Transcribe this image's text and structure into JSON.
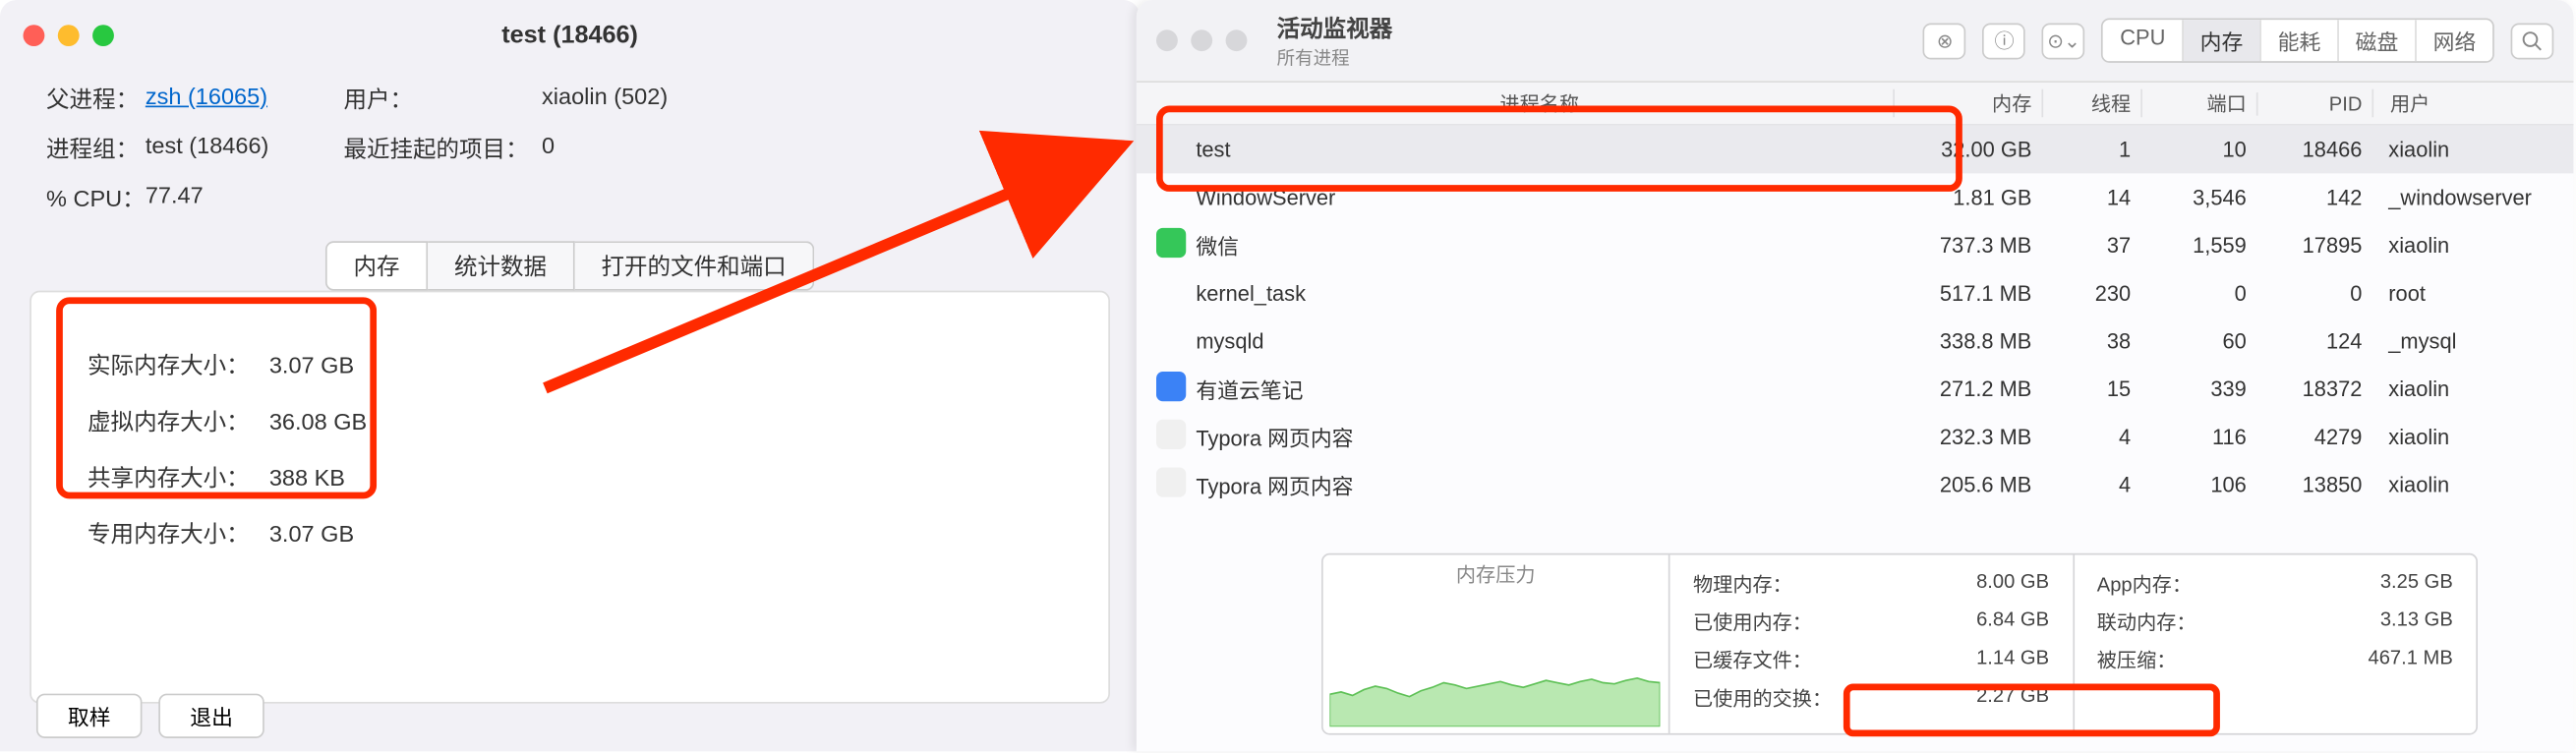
{
  "left": {
    "title": "test (18466)",
    "parent_label": "父进程：",
    "parent_value": "zsh (16065)",
    "user_label": "用户：",
    "user_value": "xiaolin (502)",
    "group_label": "进程组：",
    "group_value": "test (18466)",
    "recent_label": "最近挂起的项目：",
    "recent_value": "0",
    "cpu_label": "% CPU：",
    "cpu_value": "77.47",
    "tabs": {
      "mem": "内存",
      "stats": "统计数据",
      "files": "打开的文件和端口"
    },
    "mem": {
      "real_label": "实际内存大小：",
      "real_value": "3.07 GB",
      "virt_label": "虚拟内存大小：",
      "virt_value": "36.08 GB",
      "shared_label": "共享内存大小：",
      "shared_value": "388 KB",
      "private_label": "专用内存大小：",
      "private_value": "3.07 GB"
    },
    "buttons": {
      "sample": "取样",
      "quit": "退出"
    }
  },
  "right": {
    "title": "活动监视器",
    "subtitle": "所有进程",
    "segs": {
      "cpu": "CPU",
      "mem": "内存",
      "energy": "能耗",
      "disk": "磁盘",
      "net": "网络"
    },
    "headers": {
      "name": "进程名称",
      "mem": "内存",
      "threads": "线程",
      "ports": "端口",
      "pid": "PID",
      "user": "用户"
    },
    "rows": [
      {
        "name": "test",
        "mem": "32.00 GB",
        "threads": "1",
        "ports": "10",
        "pid": "18466",
        "user": "xiaolin",
        "icon": ""
      },
      {
        "name": "WindowServer",
        "mem": "1.81 GB",
        "threads": "14",
        "ports": "3,546",
        "pid": "142",
        "user": "_windowserver",
        "icon": ""
      },
      {
        "name": "微信",
        "mem": "737.3 MB",
        "threads": "37",
        "ports": "1,559",
        "pid": "17895",
        "user": "xiaolin",
        "icon": "#35c759"
      },
      {
        "name": "kernel_task",
        "mem": "517.1 MB",
        "threads": "230",
        "ports": "0",
        "pid": "0",
        "user": "root",
        "icon": ""
      },
      {
        "name": "mysqld",
        "mem": "338.8 MB",
        "threads": "38",
        "ports": "60",
        "pid": "124",
        "user": "_mysql",
        "icon": ""
      },
      {
        "name": "有道云笔记",
        "mem": "271.2 MB",
        "threads": "15",
        "ports": "339",
        "pid": "18372",
        "user": "xiaolin",
        "icon": "#3b82f6"
      },
      {
        "name": "Typora 网页内容",
        "mem": "232.3 MB",
        "threads": "4",
        "ports": "116",
        "pid": "4279",
        "user": "xiaolin",
        "icon": "#f0f0f0"
      },
      {
        "name": "Typora 网页内容",
        "mem": "205.6 MB",
        "threads": "4",
        "ports": "106",
        "pid": "13850",
        "user": "xiaolin",
        "icon": "#f0f0f0"
      }
    ],
    "pressure_title": "内存压力",
    "stats1": {
      "phys_label": "物理内存：",
      "phys_value": "8.00 GB",
      "used_label": "已使用内存：",
      "used_value": "6.84 GB",
      "cache_label": "已缓存文件：",
      "cache_value": "1.14 GB",
      "swap_label": "已使用的交换：",
      "swap_value": "2.27 GB"
    },
    "stats2": {
      "app_label": "App内存：",
      "app_value": "3.25 GB",
      "wired_label": "联动内存：",
      "wired_value": "3.13 GB",
      "comp_label": "被压缩：",
      "comp_value": "467.1 MB"
    }
  },
  "chart_data": {
    "type": "area",
    "title": "内存压力",
    "ylim": [
      0,
      100
    ],
    "values": [
      28,
      30,
      27,
      32,
      35,
      33,
      29,
      26,
      31,
      34,
      38,
      36,
      33,
      35,
      37,
      39,
      36,
      34,
      37,
      40,
      38,
      36,
      39,
      41,
      38,
      37,
      40,
      42,
      39,
      38
    ]
  }
}
